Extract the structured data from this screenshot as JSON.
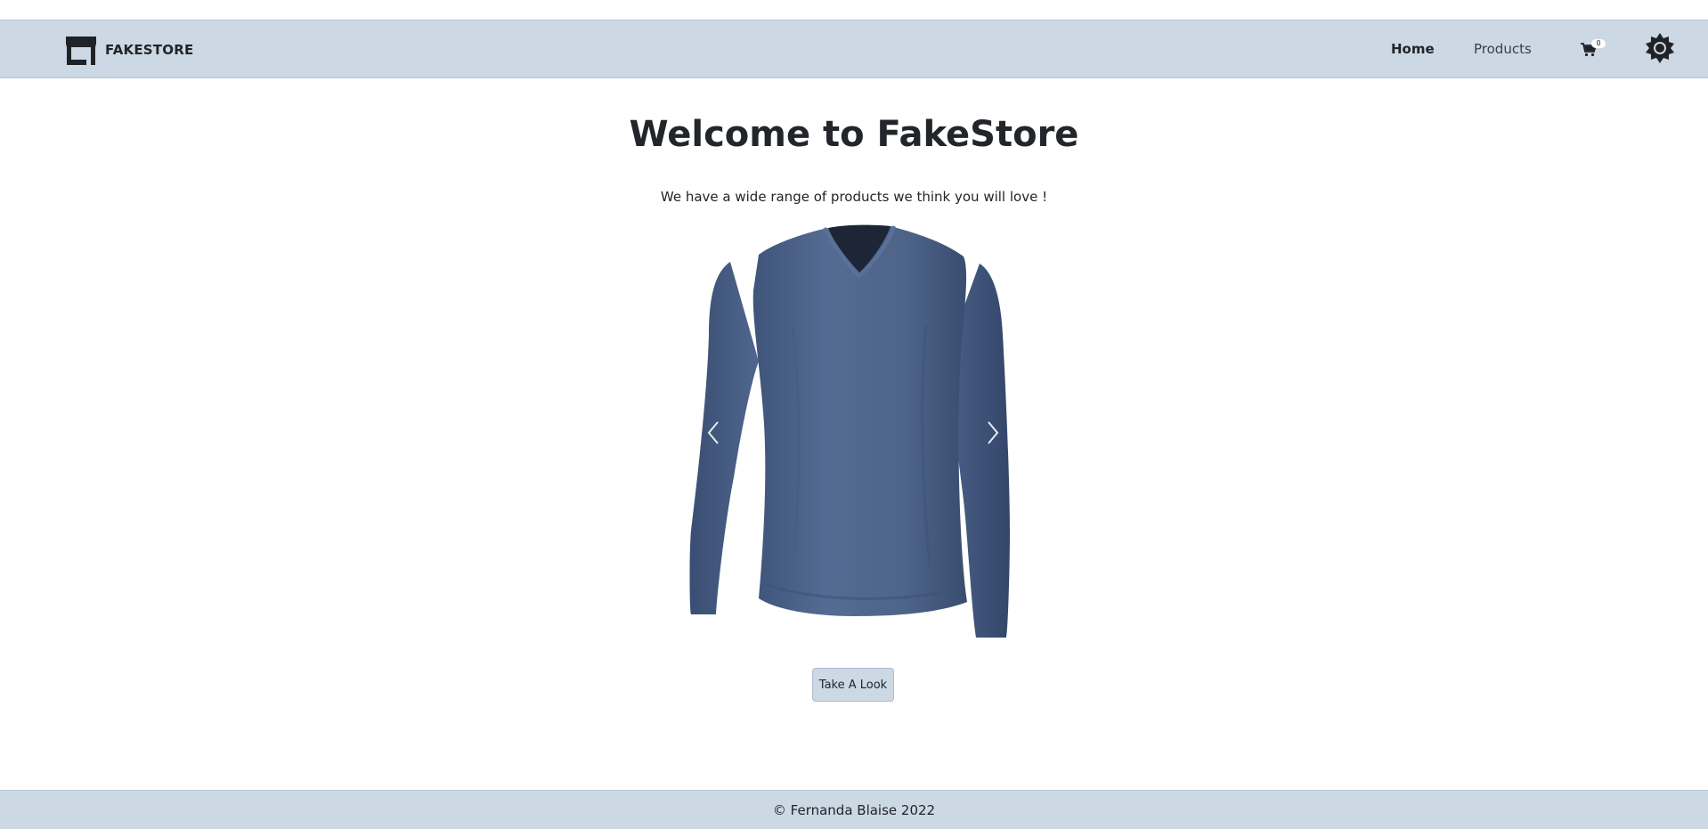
{
  "navbar": {
    "brand": "FAKESTORE",
    "links": [
      {
        "label": "Home",
        "active": true
      },
      {
        "label": "Products",
        "active": false
      }
    ],
    "cart_count": "0",
    "icons": {
      "logo": "storefront-icon",
      "cart": "cart-icon",
      "theme": "sun-gear-icon"
    }
  },
  "hero": {
    "title": "Welcome to FakeStore",
    "subtitle": "We have a wide range of products we think you will love !",
    "carousel": {
      "current_image": "blue long-sleeve v-neck t-shirt",
      "prev_icon": "chevron-left-icon",
      "next_icon": "chevron-right-icon"
    },
    "cta_label": "Take A Look"
  },
  "footer": {
    "text": "© Fernanda Blaise 2022"
  },
  "colors": {
    "navbar_bg": "#cdd8e5",
    "text": "#212529",
    "shirt": "#4a6189"
  }
}
